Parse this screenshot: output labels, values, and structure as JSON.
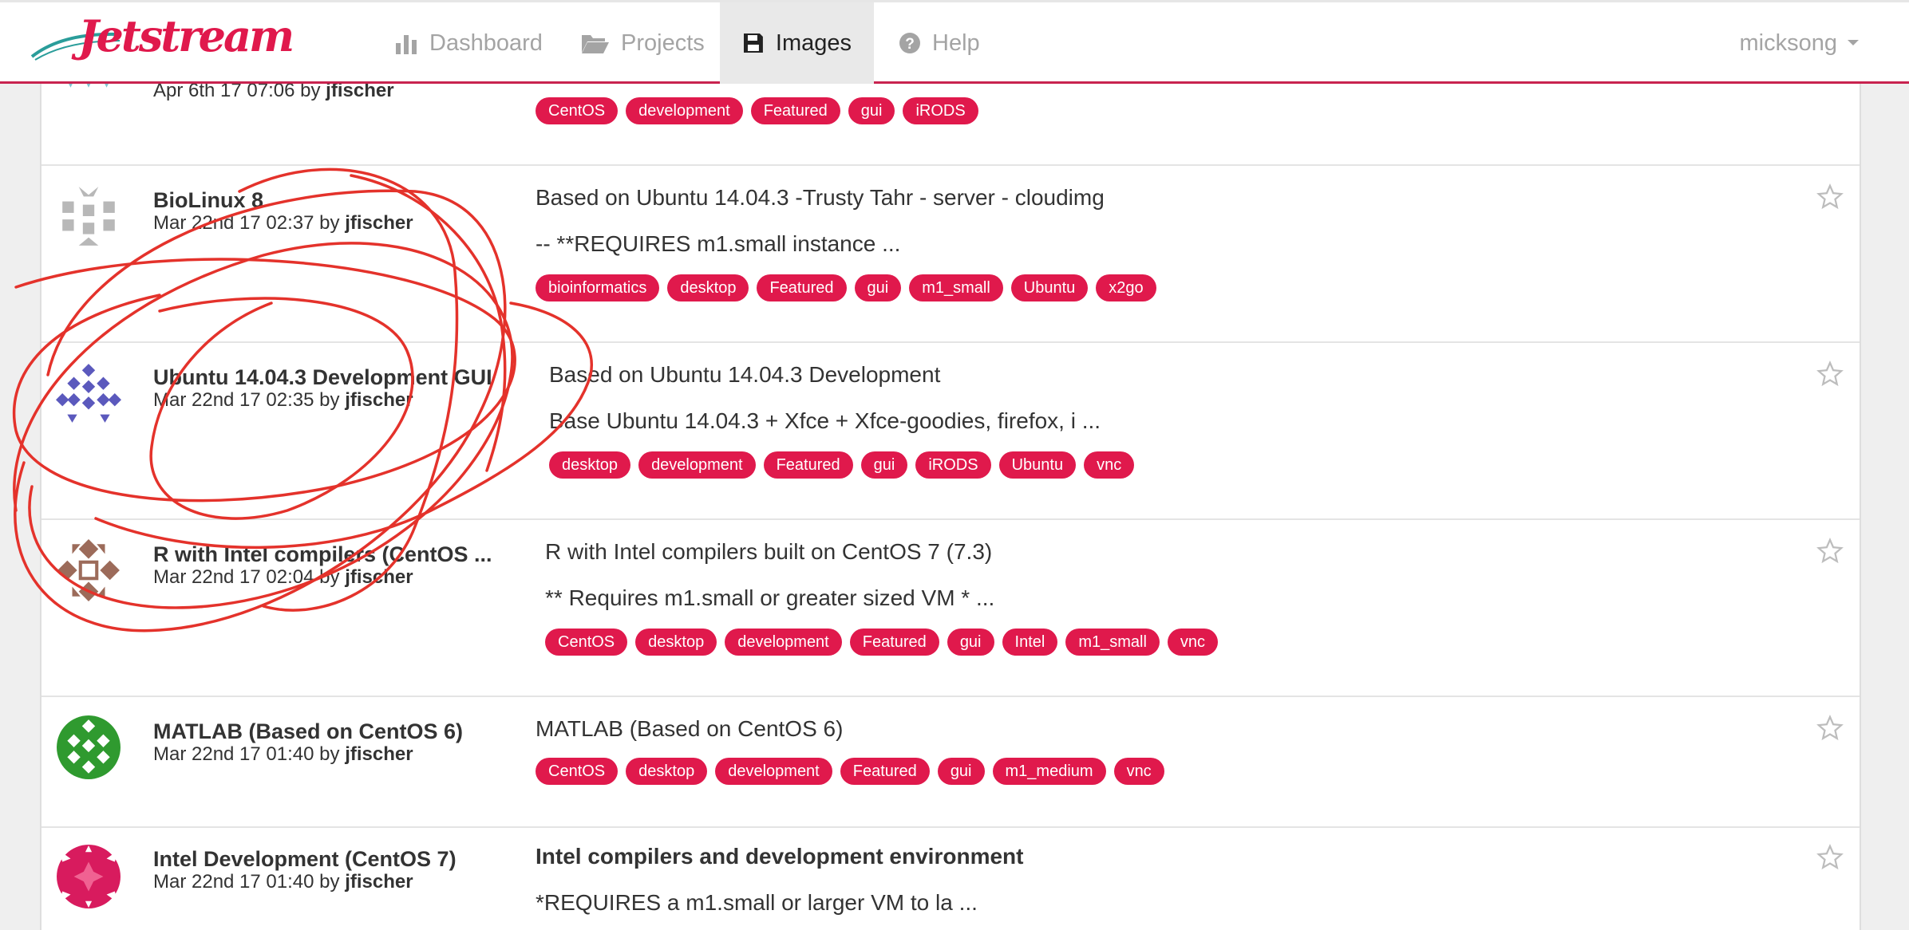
{
  "brand": {
    "name": "Jetstream"
  },
  "nav": {
    "items": [
      {
        "label": "Dashboard",
        "icon": "bar-chart-icon"
      },
      {
        "label": "Projects",
        "icon": "folder-open-icon"
      },
      {
        "label": "Images",
        "icon": "floppy-disk-icon"
      },
      {
        "label": "Help",
        "icon": "question-circle-icon"
      }
    ],
    "user": "micksong"
  },
  "colors": {
    "accent": "#e0194c",
    "navbar_border": "#c8234f"
  },
  "images": [
    {
      "name": "",
      "date": "Apr 6th 17 07:06",
      "by": "by",
      "author": "jfischer",
      "description": [],
      "tags": [
        "CentOS",
        "development",
        "Featured",
        "gui",
        "iRODS"
      ]
    },
    {
      "name": "BioLinux 8",
      "date": "Mar 22nd 17 02:37",
      "by": "by",
      "author": "jfischer",
      "description": [
        "Based on Ubuntu 14.04.3 -Trusty Tahr - server - cloudimg",
        "-- **REQUIRES m1.small instance ..."
      ],
      "tags": [
        "bioinformatics",
        "desktop",
        "Featured",
        "gui",
        "m1_small",
        "Ubuntu",
        "x2go"
      ]
    },
    {
      "name": "Ubuntu 14.04.3 Development GUI",
      "date": "Mar 22nd 17 02:35",
      "by": "by",
      "author": "jfischer",
      "description": [
        "Based on Ubuntu 14.04.3 Development",
        "Base Ubuntu 14.04.3 + Xfce + Xfce-goodies, firefox, i ..."
      ],
      "tags": [
        "desktop",
        "development",
        "Featured",
        "gui",
        "iRODS",
        "Ubuntu",
        "vnc"
      ]
    },
    {
      "name": "R with Intel compilers (CentOS ...",
      "date": "Mar 22nd 17 02:04",
      "by": "by",
      "author": "jfischer",
      "description": [
        "R with Intel compilers built on CentOS 7 (7.3)",
        "** Requires m1.small or greater sized VM * ..."
      ],
      "tags": [
        "CentOS",
        "desktop",
        "development",
        "Featured",
        "gui",
        "Intel",
        "m1_small",
        "vnc"
      ]
    },
    {
      "name": "MATLAB (Based on CentOS 6)",
      "date": "Mar 22nd 17 01:40",
      "by": "by",
      "author": "jfischer",
      "description": [
        "MATLAB (Based on CentOS 6)"
      ],
      "tags": [
        "CentOS",
        "desktop",
        "development",
        "Featured",
        "gui",
        "m1_medium",
        "vnc"
      ]
    },
    {
      "name": "Intel Development (CentOS 7)",
      "date": "Mar 22nd 17 01:40",
      "by": "by",
      "author": "jfischer",
      "description": [
        "Intel compilers and development environment",
        "*REQUIRES a m1.small or larger VM to la ..."
      ],
      "tags": []
    }
  ]
}
